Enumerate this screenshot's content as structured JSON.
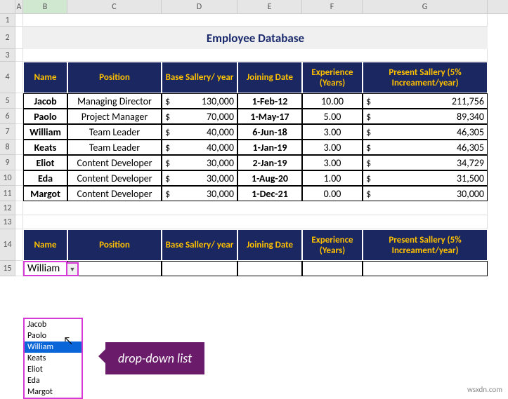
{
  "columns": [
    "A",
    "B",
    "C",
    "D",
    "E",
    "F",
    "G"
  ],
  "rows": [
    "1",
    "2",
    "3",
    "4",
    "5",
    "6",
    "7",
    "8",
    "9",
    "10",
    "11",
    "12",
    "13",
    "14",
    "15"
  ],
  "title": "Employee Database",
  "headers": {
    "name": "Name",
    "position": "Position",
    "base": "Base Sallery/ year",
    "joining": "Joining Date",
    "exp": "Experience (Years)",
    "present": "Present Sallery (5% Increament/year)"
  },
  "data": [
    {
      "name": "Jacob",
      "position": "Managing Director",
      "base": "130,000",
      "joining": "1-Feb-12",
      "exp": "10.00",
      "present": "211,756"
    },
    {
      "name": "Paolo",
      "position": "Project Manager",
      "base": "70,000",
      "joining": "1-May-17",
      "exp": "5.00",
      "present": "89,340"
    },
    {
      "name": "William",
      "position": "Team Leader",
      "base": "40,000",
      "joining": "6-Jun-18",
      "exp": "3.00",
      "present": "46,305"
    },
    {
      "name": "Keats",
      "position": "Team Leader",
      "base": "40,000",
      "joining": "1-Jan-19",
      "exp": "3.00",
      "present": "46,305"
    },
    {
      "name": "Eliot",
      "position": "Content Developer",
      "base": "30,000",
      "joining": "2-Jan-19",
      "exp": "3.00",
      "present": "34,729"
    },
    {
      "name": "Eda",
      "position": "Content Developer",
      "base": "30,000",
      "joining": "1-Aug-20",
      "exp": "1.00",
      "present": "31,500"
    },
    {
      "name": "Margot",
      "position": "Content Developer",
      "base": "30,000",
      "joining": "1-Dec-21",
      "exp": "0.00",
      "present": "30,000"
    }
  ],
  "dropdown": {
    "selected": "William",
    "options": [
      "Jacob",
      "Paolo",
      "William",
      "Keats",
      "Eliot",
      "Eda",
      "Margot"
    ],
    "highlight": "William"
  },
  "callout": "drop-down list",
  "watermark": "wsxdn.com",
  "currency": "$"
}
